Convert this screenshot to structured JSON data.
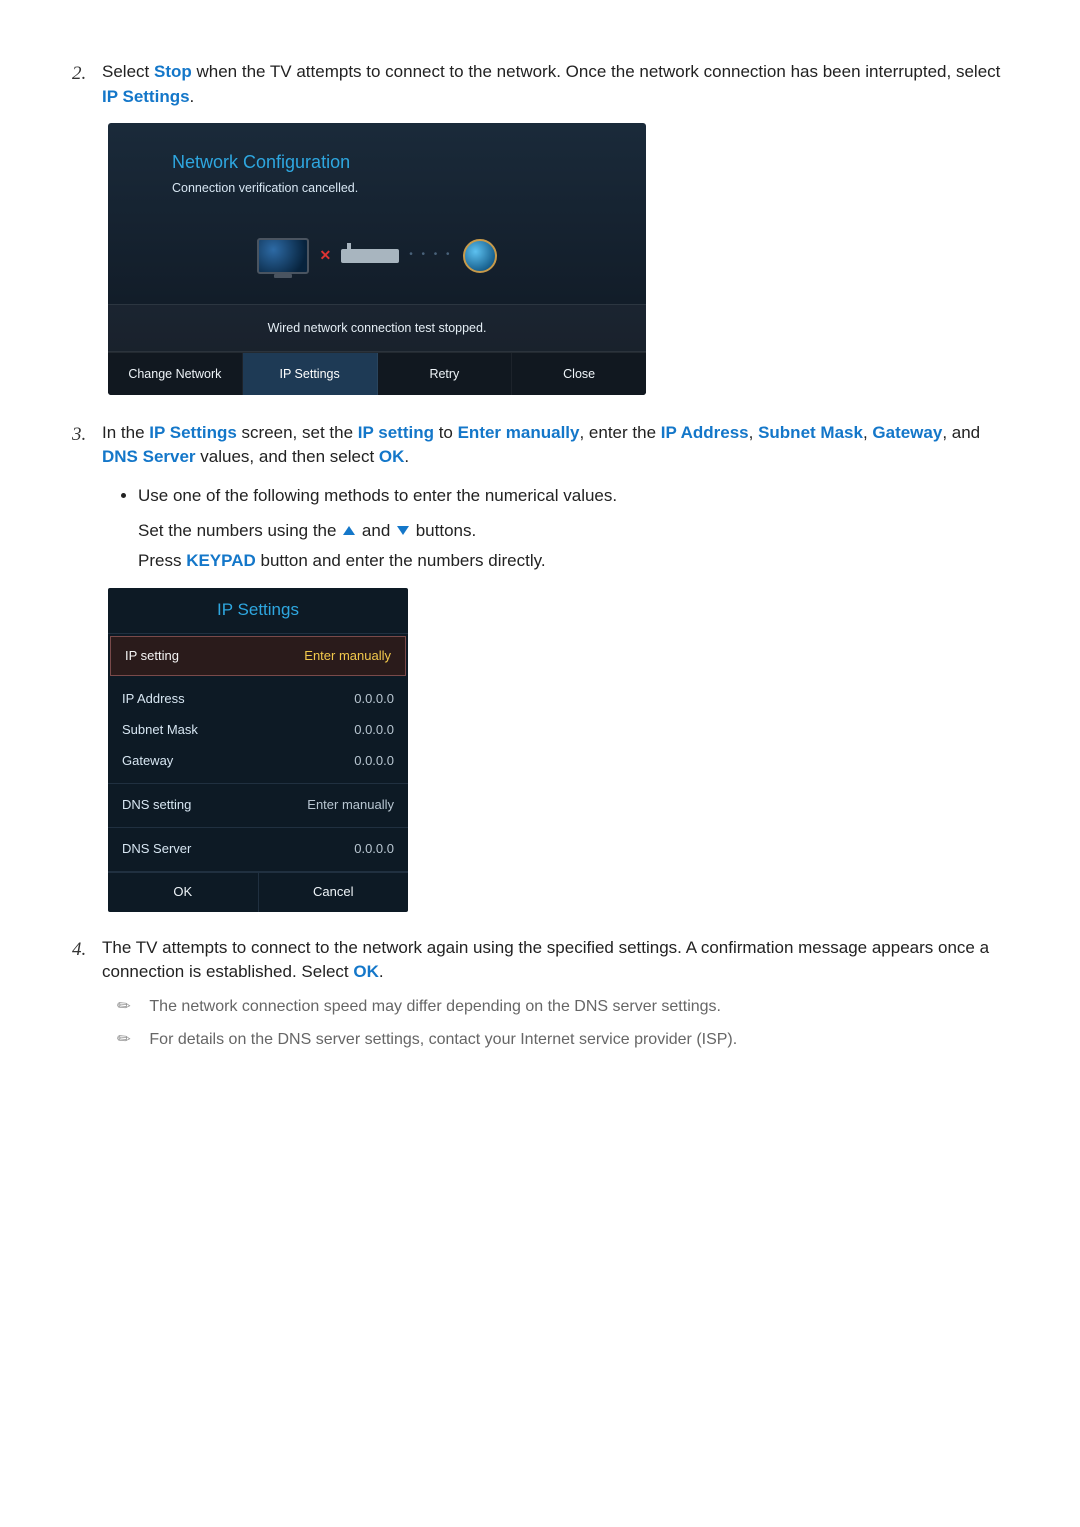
{
  "step2": {
    "num": "2.",
    "text_a": "Select ",
    "stop": "Stop",
    "text_b": " when the TV attempts to connect to the network. Once the network connection has been interrupted, select ",
    "ip_settings": "IP Settings",
    "text_c": "."
  },
  "panel1": {
    "title": "Network Configuration",
    "subtitle": "Connection verification cancelled.",
    "mid": "Wired network connection test stopped.",
    "buttons": [
      "Change Network",
      "IP Settings",
      "Retry",
      "Close"
    ]
  },
  "step3": {
    "num": "3.",
    "text_a": "In the ",
    "t1": "IP Settings",
    "text_b": " screen, set the ",
    "t2": "IP setting",
    "text_c": " to ",
    "t3": "Enter manually",
    "text_d": ", enter the ",
    "t4": "IP Address",
    "text_e": ", ",
    "t5": "Subnet Mask",
    "text_f": ", ",
    "t6": "Gateway",
    "text_g": ", and ",
    "t7": "DNS Server",
    "text_h": " values, and then select ",
    "t8": "OK",
    "text_i": ".",
    "bullet": "Use one of the following methods to enter the numerical values.",
    "sub1_a": "Set the numbers using the ",
    "sub1_b": " and ",
    "sub1_c": " buttons.",
    "sub2_a": "Press ",
    "keypad": "KEYPAD",
    "sub2_b": " button and enter the numbers directly."
  },
  "panel2": {
    "title": "IP Settings",
    "ip_setting_label": "IP setting",
    "ip_setting_value": "Enter manually",
    "ip_address_label": "IP Address",
    "ip_address_value": "0.0.0.0",
    "subnet_label": "Subnet Mask",
    "subnet_value": "0.0.0.0",
    "gateway_label": "Gateway",
    "gateway_value": "0.0.0.0",
    "dns_setting_label": "DNS setting",
    "dns_setting_value": "Enter manually",
    "dns_server_label": "DNS Server",
    "dns_server_value": "0.0.0.0",
    "ok": "OK",
    "cancel": "Cancel"
  },
  "step4": {
    "num": "4.",
    "text_a": "The TV attempts to connect to the network again using the specified settings. A confirmation message appears once a connection is established. Select ",
    "ok": "OK",
    "text_b": ".",
    "note1": "The network connection speed may differ depending on the DNS server settings.",
    "note2": "For details on the DNS server settings, contact your Internet service provider (ISP)."
  }
}
